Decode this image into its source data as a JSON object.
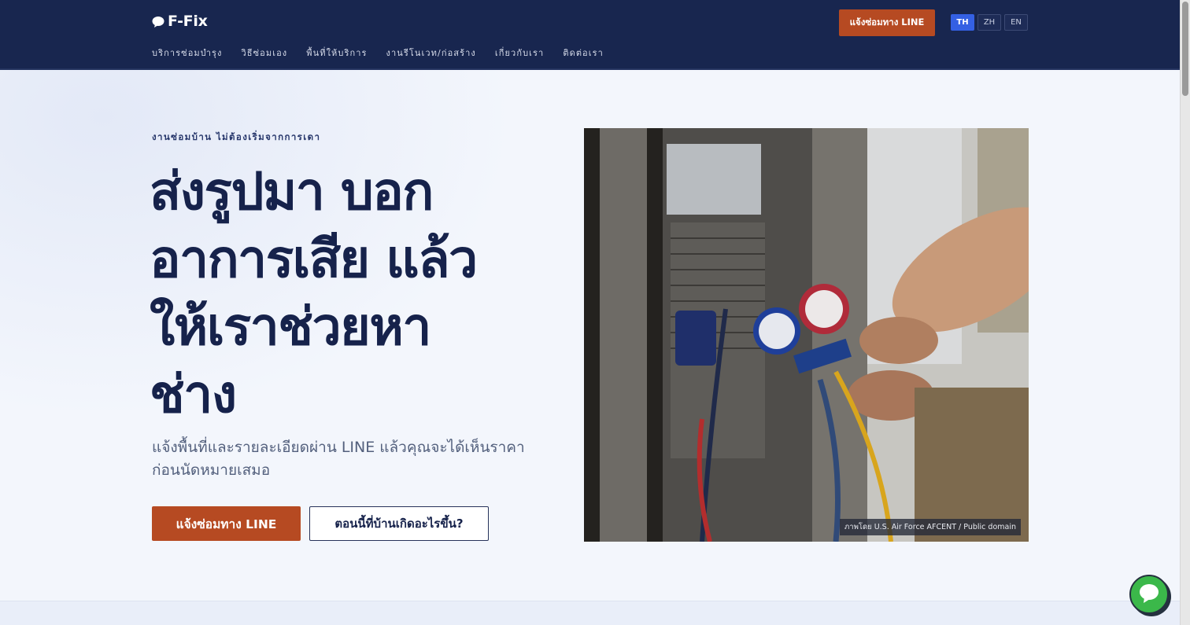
{
  "header": {
    "logo_text": "F-Fix",
    "logo_icon": "speech-bubble-icon",
    "nav": [
      {
        "label": "บริการซ่อมบำรุง"
      },
      {
        "label": "วิธีซ่อมเอง"
      },
      {
        "label": "พื้นที่ให้บริการ"
      },
      {
        "label": "งานรีโนเวท/ก่อสร้าง"
      },
      {
        "label": "เกี่ยวกับเรา"
      },
      {
        "label": "ติดต่อเรา"
      }
    ],
    "cta_label": "แจ้งซ่อมทาง LINE",
    "languages": [
      "TH",
      "ZH",
      "EN"
    ],
    "active_language": "TH"
  },
  "hero": {
    "eyebrow": "งานซ่อมบ้าน ไม่ต้องเริ่มจากการเดา",
    "title_lines": [
      "ส่งรูปมา บอก",
      "อาการเสีย แล้ว",
      "ให้เราช่วยหา",
      "ช่าง"
    ],
    "subtitle": "แจ้งพื้นที่และรายละเอียดผ่าน LINE แล้วคุณจะได้เห็นราคาก่อนนัดหมายเสมอ",
    "primary_button": "แจ้งซ่อมทาง LINE",
    "secondary_button": "ตอนนี้ที่บ้านเกิดอะไรขึ้น?",
    "photo_credit": "ภาพโดย U.S. Air Force AFCENT / Public domain"
  },
  "floating": {
    "line_button_icon": "line-chat-icon"
  },
  "colors": {
    "header_bg": "#18264f",
    "accent": "#b64a22",
    "hero_text": "#16224b",
    "active_lang": "#3460e3",
    "line_green": "#3bb84a"
  }
}
